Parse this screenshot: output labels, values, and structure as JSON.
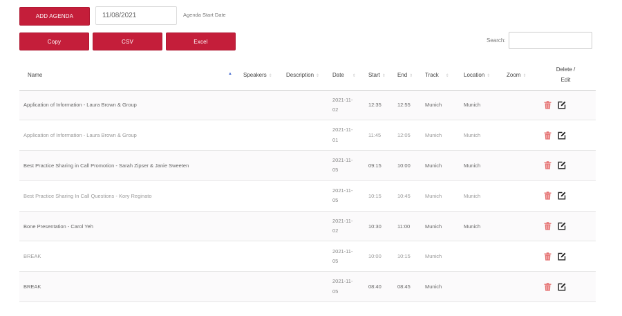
{
  "toolbar": {
    "add_agenda_label": "ADD AGENDA",
    "start_date_value": "11/08/2021",
    "start_date_label": "Agenda Start Date",
    "copy_label": "Copy",
    "csv_label": "CSV",
    "excel_label": "Excel",
    "search_label": "Search:",
    "search_value": ""
  },
  "table": {
    "columns": {
      "name": "Name",
      "speakers": "Speakers",
      "description": "Description",
      "date": "Date",
      "start": "Start",
      "end": "End",
      "track": "Track",
      "location": "Location",
      "zoom": "Zoom",
      "delete_edit_line1": "Delete /",
      "delete_edit_line2": "Edit"
    },
    "rows": [
      {
        "name": "Application of Information - Laura Brown & Group",
        "date1": "2021-11-",
        "date2": "02",
        "start": "12:35",
        "end": "12:55",
        "track": "Munich",
        "location": "Munich"
      },
      {
        "name": "Application of Information - Laura Brown & Group",
        "date1": "2021-11-",
        "date2": "01",
        "start": "11:45",
        "end": "12:05",
        "track": "Munich",
        "location": "Munich"
      },
      {
        "name": "Best Practice Sharing in Call Promotion - Sarah Zipser & Janie Sweeten",
        "date1": "2021-11-",
        "date2": "05",
        "start": "09:15",
        "end": "10:00",
        "track": "Munich",
        "location": "Munich"
      },
      {
        "name": "Best Practice Sharing In Call Questions - Kory Reginato",
        "date1": "2021-11-",
        "date2": "05",
        "start": "10:15",
        "end": "10:45",
        "track": "Munich",
        "location": "Munich"
      },
      {
        "name": "Bone Presentation - Carol Yeh",
        "date1": "2021-11-",
        "date2": "02",
        "start": "10:30",
        "end": "11:00",
        "track": "Munich",
        "location": "Munich"
      },
      {
        "name": "BREAK",
        "date1": "2021-11-",
        "date2": "05",
        "start": "10:00",
        "end": "10:15",
        "track": "Munich",
        "location": ""
      },
      {
        "name": "BREAK",
        "date1": "2021-11-",
        "date2": "05",
        "start": "08:40",
        "end": "08:45",
        "track": "Munich",
        "location": ""
      }
    ]
  },
  "colors": {
    "accent": "#c41e3a",
    "trash_icon": "#e57373",
    "sort_active": "#4a6fd1"
  },
  "icons": {
    "trash": "trash-icon",
    "edit": "edit-icon",
    "sort": "sort-icon"
  }
}
